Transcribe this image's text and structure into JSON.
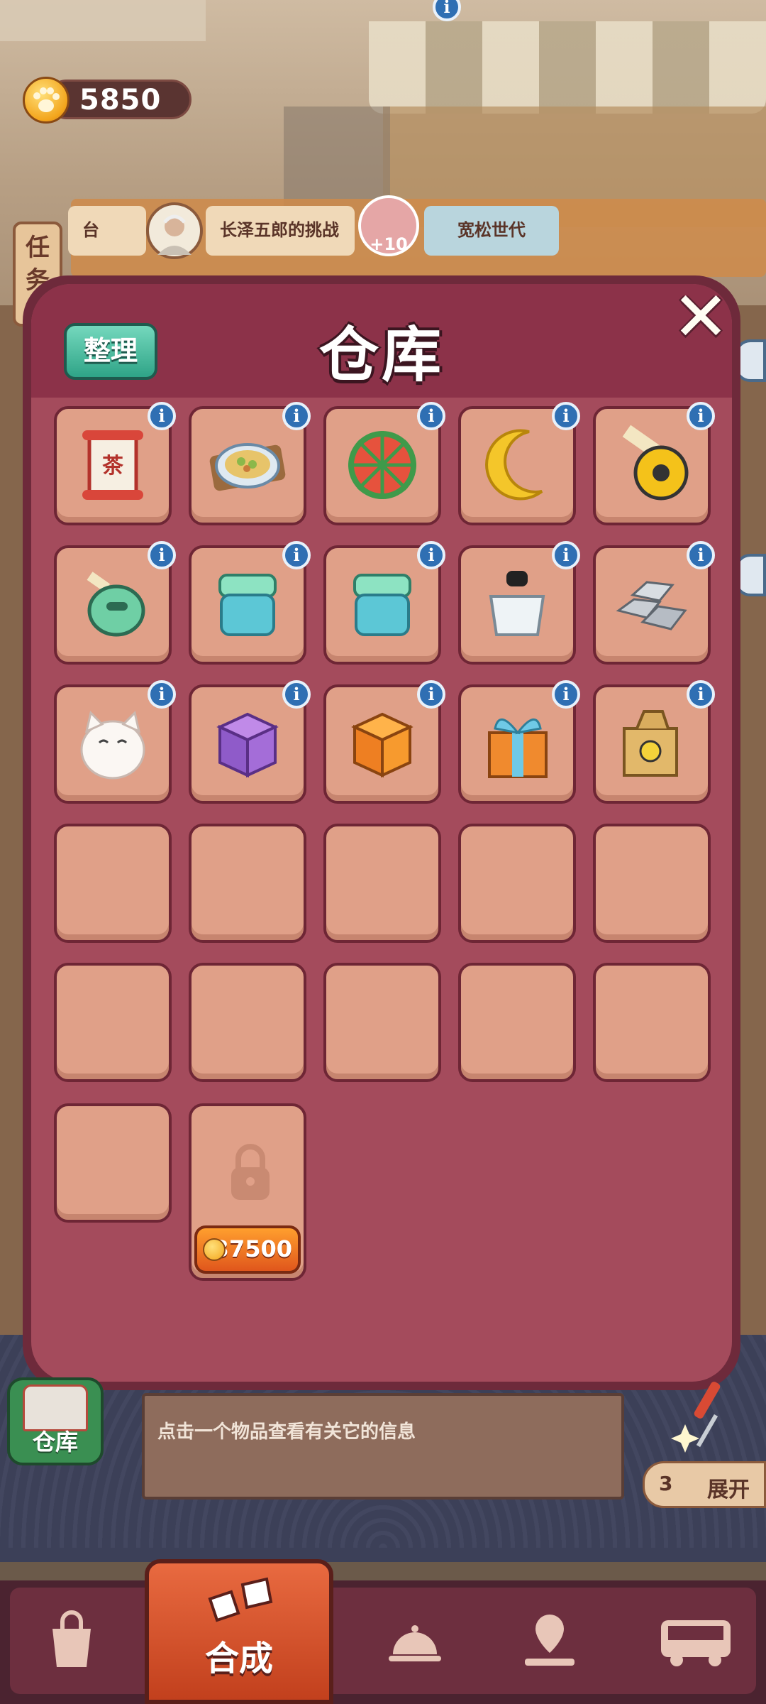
{
  "hud": {
    "coins": "5850",
    "task_tab": "任务"
  },
  "orders": [
    {
      "label": "台"
    },
    {
      "label": "长泽五郎的挑战"
    },
    {
      "label": "+10"
    },
    {
      "label": "宽松世代"
    }
  ],
  "warehouse": {
    "title": "仓库",
    "sort_button": "整理",
    "info_glyph": "i",
    "close_glyph": "✕",
    "slots_filled": [
      {
        "icon": "tea-scroll-icon"
      },
      {
        "icon": "food-plate-icon"
      },
      {
        "icon": "watermelon-icon"
      },
      {
        "icon": "crescent-moon-icon"
      },
      {
        "icon": "tape-measure-icon"
      },
      {
        "icon": "green-tape-measure-icon"
      },
      {
        "icon": "green-jar-icon"
      },
      {
        "icon": "green-jar-icon"
      },
      {
        "icon": "ink-bottle-icon"
      },
      {
        "icon": "silver-ingots-icon"
      },
      {
        "icon": "lucky-cat-icon"
      },
      {
        "icon": "purple-chest-icon"
      },
      {
        "icon": "orange-chest-icon"
      },
      {
        "icon": "gift-box-icon"
      },
      {
        "icon": "cardboard-box-icon"
      }
    ],
    "empty_slots": 11,
    "unlock_price": "37500"
  },
  "hint": {
    "text": "点击一个物品查看有关它的信息"
  },
  "warehouse_button": "仓库",
  "expand": {
    "count": "3",
    "label": "展开"
  },
  "nav": {
    "items": [
      {
        "icon": "bag-icon"
      },
      {
        "icon": "merge-icon",
        "label": "合成"
      },
      {
        "icon": "cloche-icon"
      },
      {
        "icon": "map-pin-icon"
      },
      {
        "icon": "bus-icon"
      }
    ]
  },
  "colors": {
    "panel_border": "#6e2a3b",
    "panel_fill": "#a44b5c",
    "slot_fill": "#e0a088",
    "sort_button": "#2fa487",
    "info_badge": "#2f6fb3",
    "nav_active": "#e86a40"
  }
}
